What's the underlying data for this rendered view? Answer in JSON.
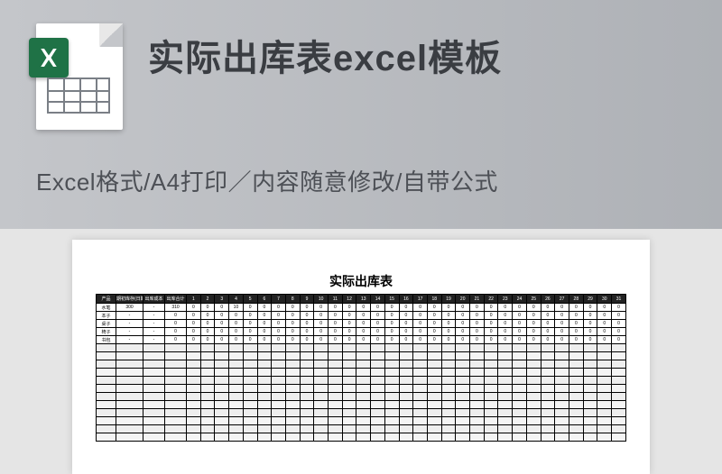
{
  "header": {
    "title": "实际出库表excel模板",
    "subtitle": "Excel格式/A4打印／内容随意修改/自带公式"
  },
  "document": {
    "title": "实际出库表",
    "columns_fixed": [
      "产品",
      "期初库存(日期)",
      "出库成本",
      "出库合计"
    ],
    "day_count": 31,
    "rows": [
      {
        "product": "水笔",
        "opening": "300",
        "cost": "-",
        "total": "310",
        "days": [
          0,
          0,
          0,
          10,
          0,
          0,
          0,
          0,
          0,
          0,
          0,
          0,
          0,
          0,
          0,
          0,
          0,
          0,
          0,
          0,
          0,
          0,
          0,
          0,
          0,
          0,
          0,
          0,
          0,
          0,
          0
        ]
      },
      {
        "product": "本子",
        "opening": "-",
        "cost": "-",
        "total": "0",
        "days": [
          0,
          0,
          0,
          0,
          0,
          0,
          0,
          0,
          0,
          0,
          0,
          0,
          0,
          0,
          0,
          0,
          0,
          0,
          0,
          0,
          0,
          0,
          0,
          0,
          0,
          0,
          0,
          0,
          0,
          0,
          0
        ]
      },
      {
        "product": "桌子",
        "opening": "-",
        "cost": "-",
        "total": "0",
        "days": [
          0,
          0,
          0,
          0,
          0,
          0,
          0,
          0,
          0,
          0,
          0,
          0,
          0,
          0,
          0,
          0,
          0,
          0,
          0,
          0,
          0,
          0,
          0,
          0,
          0,
          0,
          0,
          0,
          0,
          0,
          0
        ]
      },
      {
        "product": "椅子",
        "opening": "-",
        "cost": "-",
        "total": "0",
        "days": [
          0,
          0,
          0,
          0,
          0,
          0,
          0,
          0,
          0,
          0,
          0,
          0,
          0,
          0,
          0,
          0,
          0,
          0,
          0,
          0,
          0,
          0,
          0,
          0,
          0,
          0,
          0,
          0,
          0,
          0,
          0
        ]
      },
      {
        "product": "书包",
        "opening": "-",
        "cost": "-",
        "total": "0",
        "days": [
          0,
          0,
          0,
          0,
          0,
          0,
          0,
          0,
          0,
          0,
          0,
          0,
          0,
          0,
          0,
          0,
          0,
          0,
          0,
          0,
          0,
          0,
          0,
          0,
          0,
          0,
          0,
          0,
          0,
          0,
          0
        ]
      }
    ],
    "empty_rows": 12
  }
}
